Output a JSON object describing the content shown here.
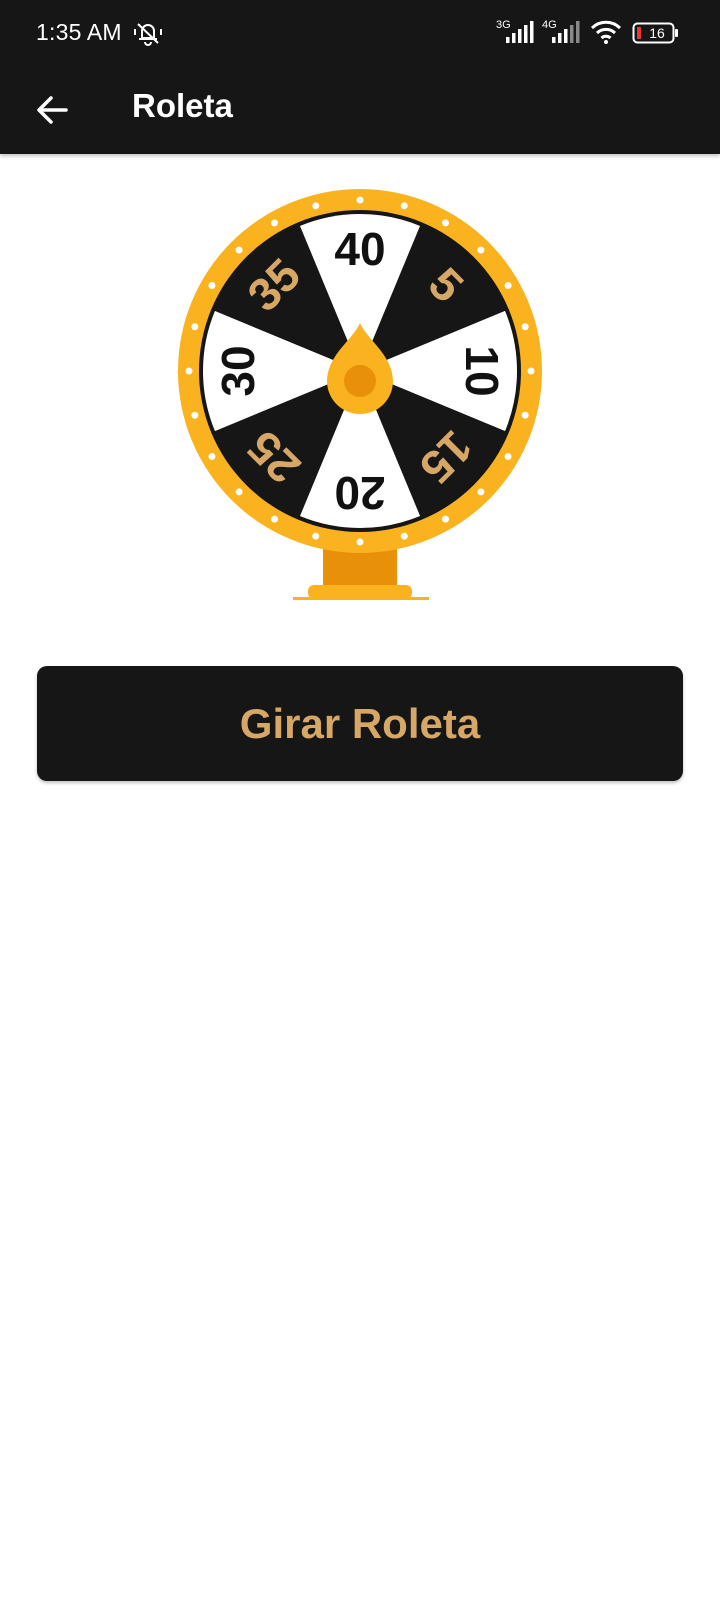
{
  "status_bar": {
    "time": "1:35 AM",
    "network_1": "3G",
    "network_2": "4G",
    "battery_level": "16",
    "icons": [
      "muted-bell-icon",
      "signal-3g-icon",
      "signal-4g-icon",
      "wifi-icon",
      "battery-icon"
    ]
  },
  "app_bar": {
    "title": "Roleta",
    "back_icon": "arrow-left-icon"
  },
  "wheel": {
    "segments": [
      "40",
      "5",
      "10",
      "15",
      "20",
      "25",
      "30",
      "35"
    ],
    "colors": {
      "rim": "#fbb21f",
      "dark_segment": "#161616",
      "light_segment": "#ffffff",
      "gold_text": "#d7a765",
      "stand": "#e8900a"
    }
  },
  "spin_button": {
    "label": "Girar Roleta"
  }
}
